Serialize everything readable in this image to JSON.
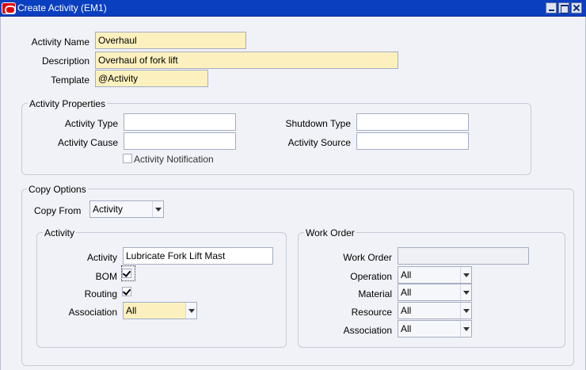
{
  "window": {
    "title": "Create Activity (EM1)"
  },
  "header": {
    "activity_name": {
      "label": "Activity Name",
      "value": "Overhaul"
    },
    "description": {
      "label": "Description",
      "value": "Overhaul of fork lift"
    },
    "template": {
      "label": "Template",
      "value": "@Activity"
    }
  },
  "properties": {
    "legend": "Activity Properties",
    "activity_type": {
      "label": "Activity Type",
      "value": ""
    },
    "activity_cause": {
      "label": "Activity Cause",
      "value": ""
    },
    "shutdown_type": {
      "label": "Shutdown Type",
      "value": ""
    },
    "activity_source": {
      "label": "Activity Source",
      "value": ""
    },
    "notification": {
      "label": "Activity Notification",
      "checked": false
    }
  },
  "copy_options": {
    "legend": "Copy Options",
    "copy_from": {
      "label": "Copy From",
      "value": "Activity"
    },
    "activity_group": {
      "legend": "Activity",
      "activity": {
        "label": "Activity",
        "value": "Lubricate Fork Lift Mast"
      },
      "bom": {
        "label": "BOM",
        "checked": true
      },
      "routing": {
        "label": "Routing",
        "checked": true
      },
      "association": {
        "label": "Association",
        "value": "All"
      }
    },
    "work_order_group": {
      "legend": "Work Order",
      "work_order": {
        "label": "Work Order",
        "value": ""
      },
      "operation": {
        "label": "Operation",
        "value": "All"
      },
      "material": {
        "label": "Material",
        "value": "All"
      },
      "resource": {
        "label": "Resource",
        "value": "All"
      },
      "association": {
        "label": "Association",
        "value": "All"
      }
    }
  }
}
